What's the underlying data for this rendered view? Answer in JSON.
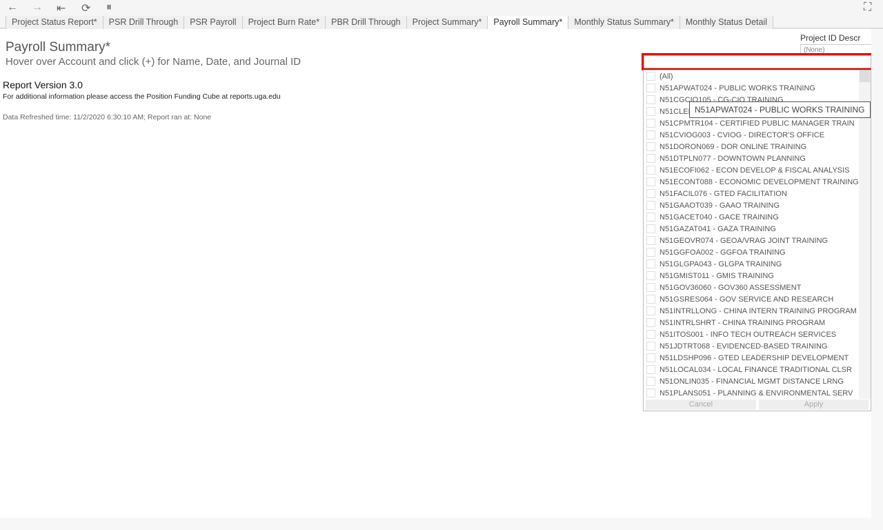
{
  "toolbar": {
    "back": "←",
    "forward": "→",
    "first": "⇤",
    "refresh": "⟳",
    "pause": "⏸",
    "fullscreen": "⛶"
  },
  "tabs": [
    {
      "label": "Project Status Report*"
    },
    {
      "label": "PSR Drill Through"
    },
    {
      "label": "PSR Payroll"
    },
    {
      "label": "Project Burn Rate*"
    },
    {
      "label": "PBR Drill Through"
    },
    {
      "label": "Project Summary*"
    },
    {
      "label": "Payroll Summary*",
      "active": true
    },
    {
      "label": "Monthly Status Summary*"
    },
    {
      "label": "Monthly Status Detail"
    }
  ],
  "page": {
    "title": "Payroll Summary*",
    "subtitle": "Hover over Account and click (+) for Name, Date, and Journal ID",
    "version": "Report Version 3.0",
    "info": "For additional information please access the Position Funding Cube at reports.uga.edu",
    "refresh": "Data Refreshed time: 11/2/2020 6:30:10 AM; Report ran at: None"
  },
  "filter": {
    "label": "Project ID Descr",
    "value": "(None)",
    "search_value": "",
    "items": [
      "(All)",
      "N51APWAT024 - PUBLIC WORKS TRAINING",
      "N51CGCIO105 - CG-CIO TRAINING",
      "N51CLER",
      "N51CPMTR104 - CERTIFIED PUBLIC MANAGER TRAIN",
      "N51CVIOG003 - CVIOG - DIRECTOR'S OFFICE",
      "N51DORON069 - DOR ONLINE TRAINING",
      "N51DTPLN077 - DOWNTOWN PLANNING",
      "N51ECOFI062 - ECON DEVELOP & FISCAL ANALYSIS",
      "N51ECONT088 - ECONOMIC DEVELOPMENT TRAINING",
      "N51FACIL076 - GTED FACILITATION",
      "N51GAAOT039 - GAAO TRAINING",
      "N51GACET040 - GACE TRAINING",
      "N51GAZAT041 - GAZA TRAINING",
      "N51GEOVR074 - GEOA/VRAG JOINT TRAINING",
      "N51GGFOA002 - GGFOA TRAINING",
      "N51GLGPA043 - GLGPA TRAINING",
      "N51GMIST011 - GMIS TRAINING",
      "N51GOV36060 - GOV360 ASSESSMENT",
      "N51GSRES064 - GOV SERVICE AND RESEARCH",
      "N51INTRLLONG - CHINA INTERN TRAINING PROGRAM",
      "N51INTRLSHRT - CHINA TRAINING PROGRAM",
      "N51ITOS001 - INFO TECH OUTREACH SERVICES",
      "N51JDTRT068 - EVIDENCED-BASED TRAINING",
      "N51LDSHP096 - GTED LEADERSHIP DEVELOPMENT",
      "N51LOCAL034 - LOCAL FINANCE TRADITIONAL CLSR",
      "N51ONLIN035 - FINANCIAL MGMT DISTANCE LRNG",
      "N51PLANS051 - PLANNING & ENVIRONMENTAL SERV"
    ],
    "cancel": "Cancel",
    "apply": "Apply",
    "tooltip": "N51APWAT024 - PUBLIC WORKS TRAINING",
    "highlight_color": "#ee0000"
  }
}
